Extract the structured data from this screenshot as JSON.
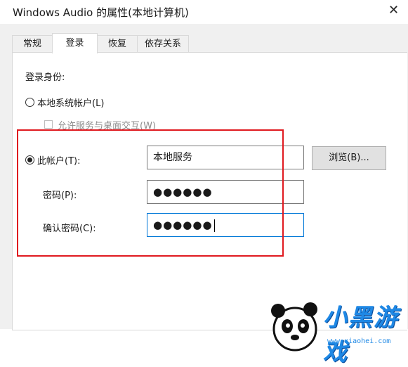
{
  "window": {
    "title": "Windows Audio 的属性(本地计算机)",
    "close_glyph": "✕"
  },
  "tabs": [
    {
      "label": "常规",
      "active": false
    },
    {
      "label": "登录",
      "active": true
    },
    {
      "label": "恢复",
      "active": false
    },
    {
      "label": "依存关系",
      "active": false
    }
  ],
  "logon": {
    "section_label": "登录身份:",
    "local_system": {
      "label": "本地系统帐户(L)",
      "selected": false
    },
    "interact_desktop": {
      "label": "允许服务与桌面交互(W)",
      "checked": false,
      "enabled": false
    },
    "this_account": {
      "label": "此帐户(T):",
      "selected": true,
      "value": "本地服务"
    },
    "browse_button": "浏览(B)...",
    "password": {
      "label": "密码(P):",
      "value": "●●●●●●"
    },
    "confirm_password": {
      "label": "确认密码(C):",
      "value": "●●●●●●"
    }
  },
  "watermark": {
    "text": "小黑游戏",
    "url": "www.xiaohei.com"
  },
  "colors": {
    "highlight_border": "#e0191f",
    "focus_border": "#0078d7",
    "watermark": "#1e88e5"
  }
}
